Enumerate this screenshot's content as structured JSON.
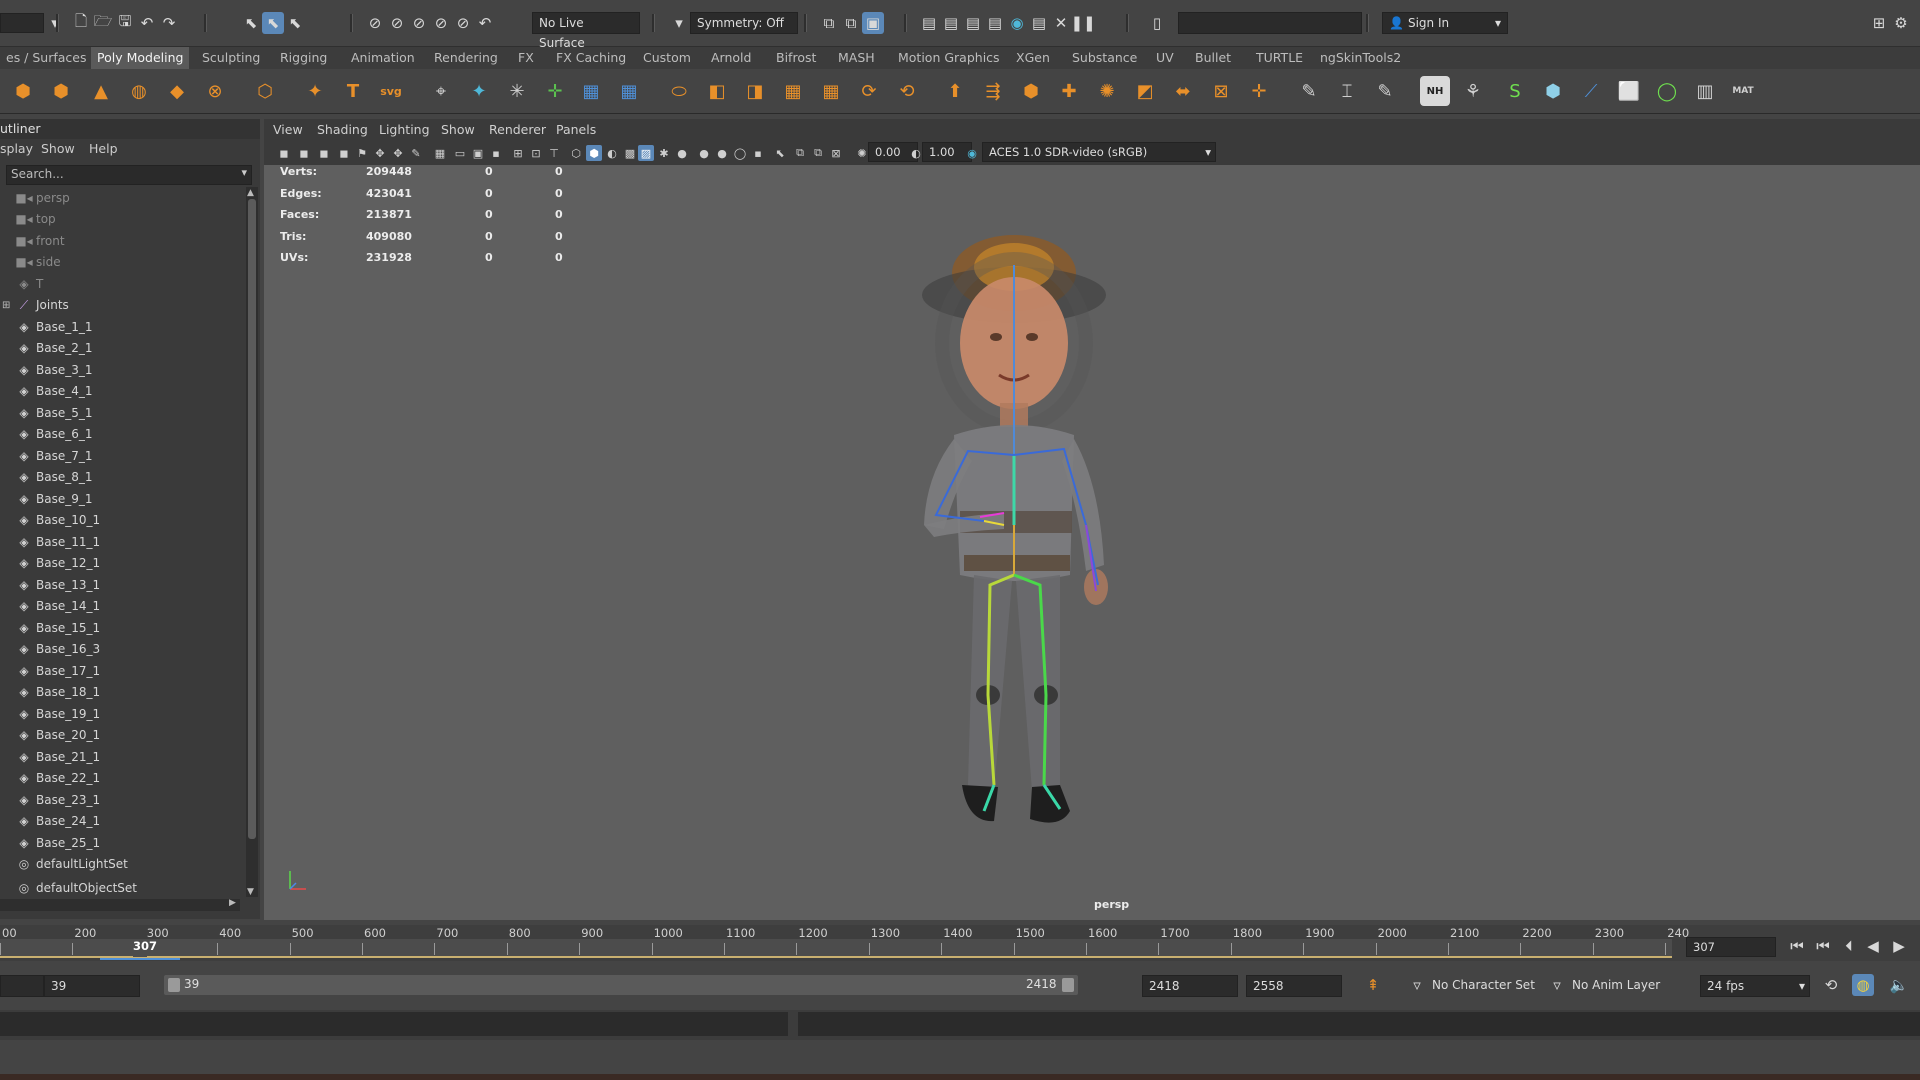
{
  "status_line": {
    "live_surface": "No Live Surface",
    "symmetry": "Symmetry: Off",
    "sign_in": "Sign In"
  },
  "shelf_tabs": [
    {
      "label": "es / Surfaces"
    },
    {
      "label": "Poly Modeling"
    },
    {
      "label": "Sculpting"
    },
    {
      "label": "Rigging"
    },
    {
      "label": "Animation"
    },
    {
      "label": "Rendering"
    },
    {
      "label": "FX"
    },
    {
      "label": "FX Caching"
    },
    {
      "label": "Custom"
    },
    {
      "label": "Arnold"
    },
    {
      "label": "Bifrost"
    },
    {
      "label": "MASH"
    },
    {
      "label": "Motion Graphics"
    },
    {
      "label": "XGen"
    },
    {
      "label": "Substance"
    },
    {
      "label": "UV"
    },
    {
      "label": "Bullet"
    },
    {
      "label": "TURTLE"
    },
    {
      "label": "ngSkinTools2"
    }
  ],
  "shelf": {
    "text_tool": "T",
    "svg_tool": "svg",
    "nh_label": "NH",
    "mat_label": "MAT"
  },
  "outliner": {
    "title": "utliner",
    "menu": [
      "splay",
      "Show",
      "Help"
    ],
    "search_placeholder": "Search...",
    "items": [
      {
        "label": "persp"
      },
      {
        "label": "top"
      },
      {
        "label": "front"
      },
      {
        "label": "side"
      },
      {
        "label": "T"
      },
      {
        "label": "Joints"
      },
      {
        "label": "Base_1_1"
      },
      {
        "label": "Base_2_1"
      },
      {
        "label": "Base_3_1"
      },
      {
        "label": "Base_4_1"
      },
      {
        "label": "Base_5_1"
      },
      {
        "label": "Base_6_1"
      },
      {
        "label": "Base_7_1"
      },
      {
        "label": "Base_8_1"
      },
      {
        "label": "Base_9_1"
      },
      {
        "label": "Base_10_1"
      },
      {
        "label": "Base_11_1"
      },
      {
        "label": "Base_12_1"
      },
      {
        "label": "Base_13_1"
      },
      {
        "label": "Base_14_1"
      },
      {
        "label": "Base_15_1"
      },
      {
        "label": "Base_16_3"
      },
      {
        "label": "Base_17_1"
      },
      {
        "label": "Base_18_1"
      },
      {
        "label": "Base_19_1"
      },
      {
        "label": "Base_20_1"
      },
      {
        "label": "Base_21_1"
      },
      {
        "label": "Base_22_1"
      },
      {
        "label": "Base_23_1"
      },
      {
        "label": "Base_24_1"
      },
      {
        "label": "Base_25_1"
      },
      {
        "label": "defaultLightSet"
      },
      {
        "label": "defaultObjectSet"
      }
    ]
  },
  "viewport": {
    "menu": [
      "View",
      "Shading",
      "Lighting",
      "Show",
      "Renderer",
      "Panels"
    ],
    "exposure": "0.00",
    "gamma": "1.00",
    "color_space": "ACES 1.0 SDR-video (sRGB)",
    "camera_label": "persp",
    "hud": [
      {
        "label": "Verts:",
        "v1": "209448",
        "v2": "0",
        "v3": "0"
      },
      {
        "label": "Edges:",
        "v1": "423041",
        "v2": "0",
        "v3": "0"
      },
      {
        "label": "Faces:",
        "v1": "213871",
        "v2": "0",
        "v3": "0"
      },
      {
        "label": "Tris:",
        "v1": "409080",
        "v2": "0",
        "v3": "0"
      },
      {
        "label": "UVs:",
        "v1": "231928",
        "v2": "0",
        "v3": "0"
      }
    ]
  },
  "time_slider": {
    "ticks": [
      "00",
      "200",
      "300",
      "400",
      "500",
      "600",
      "700",
      "800",
      "900",
      "1000",
      "1100",
      "1200",
      "1300",
      "1400",
      "1500",
      "1600",
      "1700",
      "1800",
      "1900",
      "2000",
      "2100",
      "2200",
      "2300",
      "240"
    ],
    "current_marker": "307",
    "current_frame": "307"
  },
  "range_slider": {
    "start_field": "39",
    "range_start": "39",
    "range_end": "2418",
    "end_field": "2418",
    "anim_end": "2558",
    "character_set": "No Character Set",
    "anim_layer": "No Anim Layer",
    "fps": "24 fps"
  }
}
